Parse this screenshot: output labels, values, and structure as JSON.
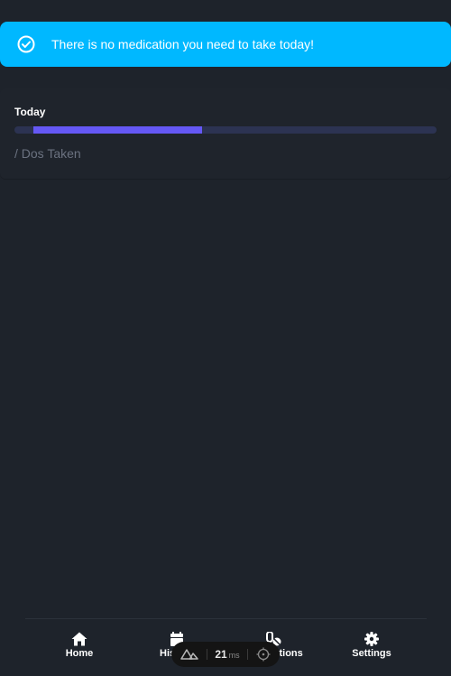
{
  "alert": {
    "message": "There is no medication you need to take today!",
    "icon": "check-circle-icon",
    "color": "#00b8ff"
  },
  "today_card": {
    "title": "Today",
    "progress_fraction": 0.4,
    "progress_color": "#6558f5",
    "track_color": "#2c3352",
    "subtitle": "/ Dos Taken"
  },
  "bottom_nav": {
    "items": [
      {
        "label": "Home",
        "icon": "home-icon"
      },
      {
        "label": "History",
        "icon": "calendar-icon"
      },
      {
        "label": "Medications",
        "icon": "pills-icon"
      },
      {
        "label": "Settings",
        "icon": "gear-icon"
      }
    ]
  },
  "devtools": {
    "icon": "nuxt-logo-icon",
    "render_time": "21",
    "render_unit": "ms",
    "inspect_icon": "crosshair-icon"
  }
}
